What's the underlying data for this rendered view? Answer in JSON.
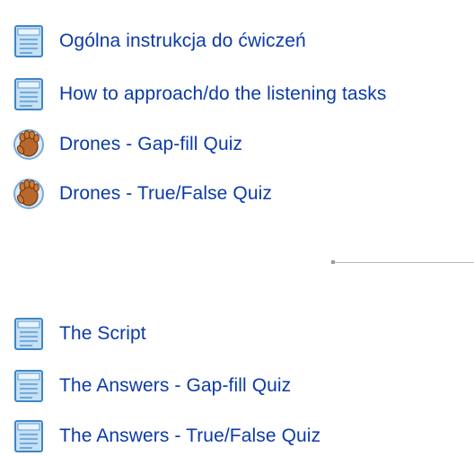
{
  "section1": {
    "items": [
      {
        "label": "Ogólna instrukcja do ćwiczeń",
        "icon": "document-icon"
      },
      {
        "label": "How to approach/do the listening tasks",
        "icon": "document-icon"
      },
      {
        "label": "Drones - Gap-fill Quiz",
        "icon": "hand-quiz-icon"
      },
      {
        "label": "Drones - True/False Quiz",
        "icon": "hand-quiz-icon"
      }
    ]
  },
  "section2": {
    "items": [
      {
        "label": "The Script",
        "icon": "document-icon"
      },
      {
        "label": "The Answers - Gap-fill Quiz",
        "icon": "document-icon"
      },
      {
        "label": "The Answers - True/False Quiz",
        "icon": "document-icon"
      }
    ]
  },
  "colors": {
    "link": "#0b3aa8",
    "doc_icon_fill": "#c6e0f4",
    "doc_icon_stroke": "#3f86c6",
    "quiz_icon_hand": "#b8682c",
    "quiz_icon_ring": "#7aa9d8"
  }
}
